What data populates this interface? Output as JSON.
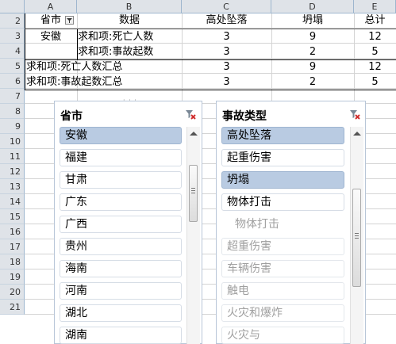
{
  "columns": [
    "A",
    "B",
    "C",
    "D",
    "E"
  ],
  "rows": [
    "2",
    "3",
    "4",
    "5",
    "6",
    "7",
    "8",
    "9",
    "10",
    "11",
    "12",
    "13",
    "14",
    "15",
    "16",
    "17",
    "18",
    "19",
    "20",
    "21"
  ],
  "pivot": {
    "header": {
      "province": "省市",
      "data": "数据",
      "c": "高处坠落",
      "d": "坍塌",
      "total": "总计"
    },
    "r3": {
      "province": "安徽",
      "label": "求和项:死亡人数",
      "c": "3",
      "d": "9",
      "e": "12"
    },
    "r4": {
      "label": "求和项:事故起数",
      "c": "3",
      "d": "2",
      "e": "5"
    },
    "r5": {
      "label": "求和项:死亡人数汇总",
      "c": "3",
      "d": "9",
      "e": "12"
    },
    "r6": {
      "label": "求和项:事故起数汇总",
      "c": "3",
      "d": "2",
      "e": "5"
    }
  },
  "slicer_province": {
    "title": "省市",
    "items": [
      "安徽",
      "福建",
      "甘肃",
      "广东",
      "广西",
      "贵州",
      "海南",
      "河南",
      "湖北",
      "湖南"
    ]
  },
  "slicer_type": {
    "title": "事故类型",
    "items": [
      "高处坠落",
      "起重伤害",
      "坍塌",
      "物体打击",
      "物体打击",
      "超重伤害",
      "车辆伤害",
      "触电",
      "火灾和爆炸",
      "火灾与"
    ]
  }
}
